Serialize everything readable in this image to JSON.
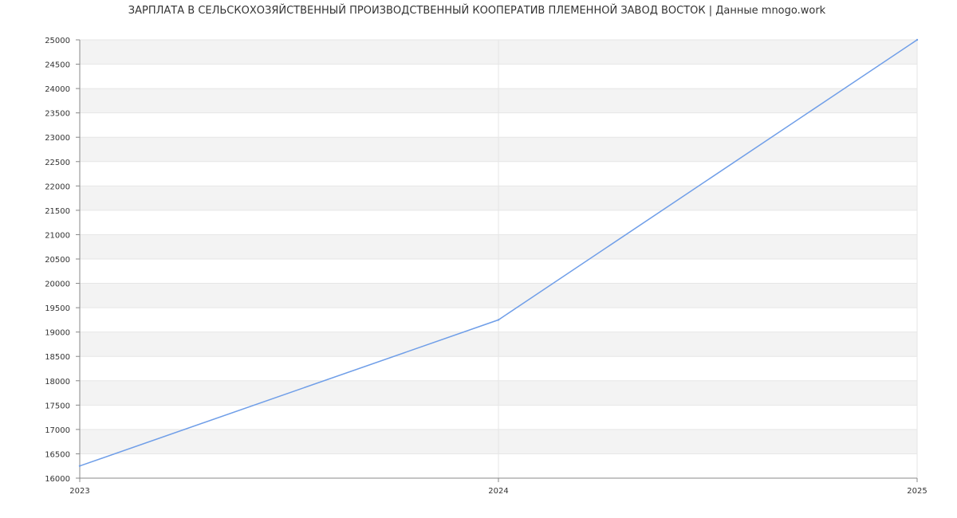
{
  "chart_data": {
    "type": "line",
    "title": "ЗАРПЛАТА В СЕЛЬСКОХОЗЯЙСТВЕННЫЙ ПРОИЗВОДСТВЕННЫЙ КООПЕРАТИВ ПЛЕМЕННОЙ ЗАВОД ВОСТОК | Данные mnogo.work",
    "xlabel": "",
    "ylabel": "",
    "x": [
      "2023",
      "2024",
      "2025"
    ],
    "series": [
      {
        "values": [
          16250,
          19250,
          25000
        ]
      }
    ],
    "ylim": [
      16000,
      25000
    ],
    "yticks": [
      16000,
      16500,
      17000,
      17500,
      18000,
      18500,
      19000,
      19500,
      20000,
      20500,
      21000,
      21500,
      22000,
      22500,
      23000,
      23500,
      24000,
      24500,
      25000
    ],
    "grid": true,
    "legend": "none",
    "colors": {
      "line": "#6f9ee8",
      "band": "#f3f3f3",
      "grid": "#e6e6e6",
      "axis": "#888888",
      "text": "#333333"
    }
  }
}
